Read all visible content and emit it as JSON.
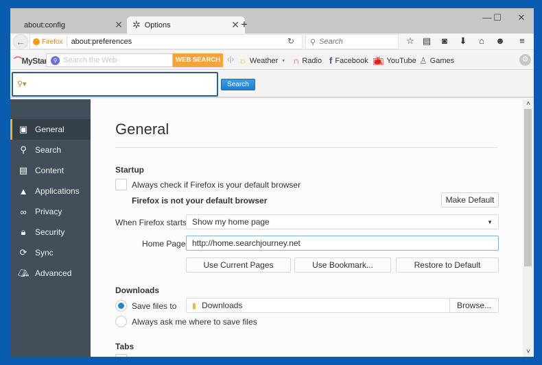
{
  "tabs": [
    {
      "label": "about:config",
      "active": false
    },
    {
      "label": "Options",
      "active": true
    }
  ],
  "window_controls": {
    "minimize": "—",
    "maximize": "☐",
    "close": "✕"
  },
  "navbar": {
    "identity_label": "Firefox",
    "url": "about:preferences",
    "search_placeholder": "Search"
  },
  "mystart": {
    "logo": "MyStart",
    "search_placeholder": "Search the Web",
    "web_search_label": "WEB SEARCH",
    "items": [
      {
        "label": "Weather",
        "icon": "sun-icon"
      },
      {
        "label": "Radio",
        "icon": "headphones-icon"
      },
      {
        "label": "Facebook",
        "icon": "facebook-icon"
      },
      {
        "label": "YouTube",
        "icon": "tv-icon"
      },
      {
        "label": "Games",
        "icon": "joystick-icon"
      }
    ]
  },
  "searchrow": {
    "input_value": "",
    "button_label": "Search"
  },
  "sidebar": {
    "items": [
      {
        "label": "General",
        "icon": "general-icon",
        "active": true
      },
      {
        "label": "Search",
        "icon": "search-icon"
      },
      {
        "label": "Content",
        "icon": "content-icon"
      },
      {
        "label": "Applications",
        "icon": "rocket-icon"
      },
      {
        "label": "Privacy",
        "icon": "mask-icon"
      },
      {
        "label": "Security",
        "icon": "lock-icon"
      },
      {
        "label": "Sync",
        "icon": "sync-icon"
      },
      {
        "label": "Advanced",
        "icon": "wizard-hat-icon"
      }
    ]
  },
  "main": {
    "title": "General",
    "startup": {
      "heading": "Startup",
      "default_check_label": "Always check if Firefox is your default browser",
      "default_check_checked": false,
      "not_default_text": "Firefox is not your default browser",
      "make_default_label": "Make Default",
      "when_starts_label": "When Firefox starts:",
      "when_starts_value": "Show my home page",
      "home_page_label": "Home Page:",
      "home_page_value": "http://home.searchjourney.net",
      "use_current_label": "Use Current Pages",
      "use_bookmark_label": "Use Bookmark...",
      "restore_default_label": "Restore to Default"
    },
    "downloads": {
      "heading": "Downloads",
      "save_files_label": "Save files to",
      "save_files_selected": true,
      "folder": "Downloads",
      "browse_label": "Browse...",
      "always_ask_label": "Always ask me where to save files"
    },
    "tabs": {
      "heading": "Tabs"
    }
  }
}
